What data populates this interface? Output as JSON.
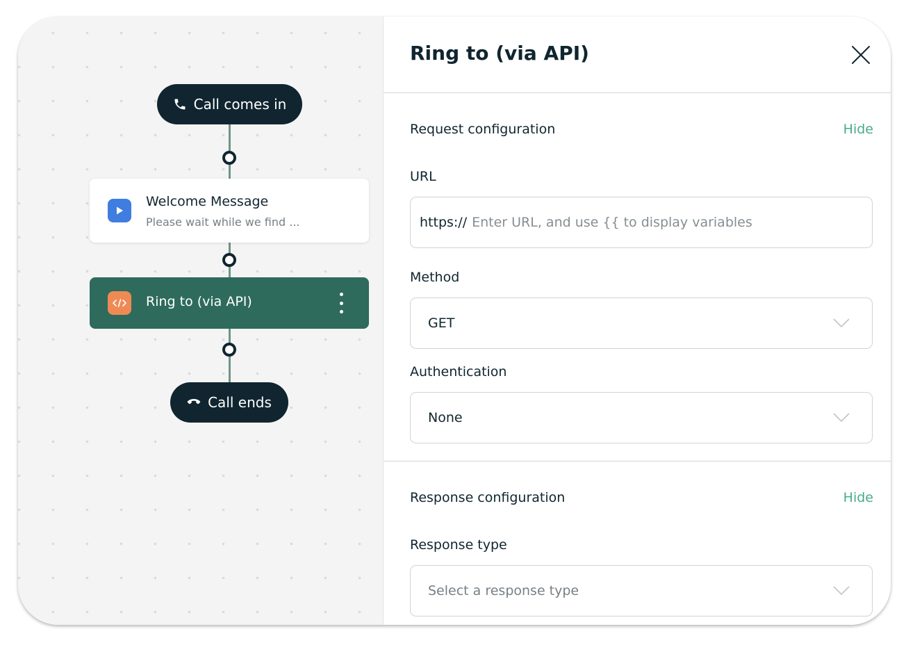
{
  "flow": {
    "start_label": "Call comes in",
    "welcome": {
      "title": "Welcome Message",
      "subtitle": "Please wait while we find ..."
    },
    "ring": {
      "title": "Ring to (via API)"
    },
    "end_label": "Call ends"
  },
  "panel": {
    "title": "Ring to (via API)",
    "request": {
      "title": "Request configuration",
      "toggle_label": "Hide",
      "url_label": "URL",
      "url_prefix": "https://",
      "url_placeholder": "Enter URL, and use {{ to display variables",
      "method_label": "Method",
      "method_value": "GET",
      "auth_label": "Authentication",
      "auth_value": "None"
    },
    "response": {
      "title": "Response configuration",
      "toggle_label": "Hide",
      "type_label": "Response type",
      "type_placeholder": "Select a response type"
    }
  },
  "colors": {
    "dark_navy": "#10252f",
    "active_node": "#2e6b5c",
    "accent_green": "#47ad86",
    "welcome_icon": "#3f7de0",
    "api_icon": "#ef8a55"
  },
  "icons": [
    "phone-icon",
    "play-icon",
    "code-icon",
    "more-vertical-icon",
    "hang-up-icon",
    "close-icon",
    "chevron-down-icon"
  ]
}
